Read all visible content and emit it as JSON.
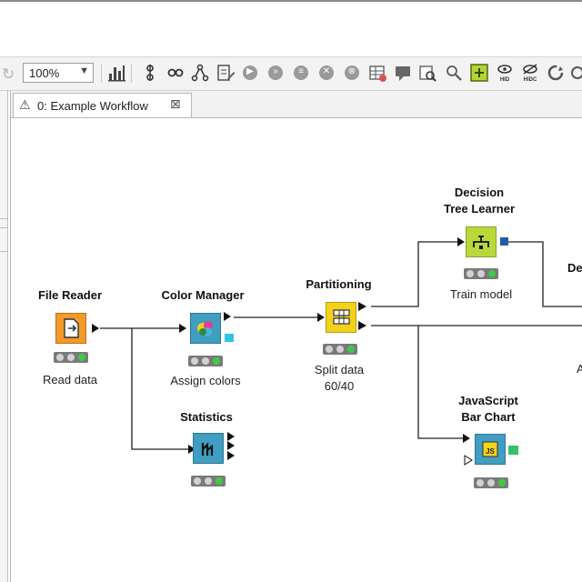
{
  "toolbar": {
    "zoom_value": "100%",
    "icons": [
      "redo-icon",
      "node-layout-icon",
      "align-icon",
      "link-icon",
      "tree-icon",
      "edit-icon",
      "execute-icon",
      "execute-all-icon",
      "step-icon",
      "cancel-icon",
      "cancel-all-icon",
      "reset-icon",
      "comment-icon",
      "find-icon",
      "zoom-icon",
      "grid-icon",
      "hide-icon",
      "hide-others-icon",
      "refresh-icon"
    ],
    "badge_hid": "HID",
    "badge_hidc": "HIDC"
  },
  "editor": {
    "tab": {
      "label": "0: Example Workflow",
      "icon": "warning-triangle-icon",
      "close": "close-icon"
    }
  },
  "workflow": {
    "nodes": {
      "file_reader": {
        "title": "File Reader",
        "description": "Read data",
        "color": "#f39a2b",
        "icon": "file-icon"
      },
      "color_manager": {
        "title": "Color Manager",
        "description": "Assign colors",
        "color": "#3f9ec1",
        "icon": "palette-icon"
      },
      "statistics": {
        "title": "Statistics",
        "description": "",
        "color": "#3f9ec1",
        "icon": "stats-icon"
      },
      "partitioning": {
        "title": "Partitioning",
        "description_line1": "Split data",
        "description_line2": "60/40",
        "color": "#f3d21b",
        "icon": "table-split-icon"
      },
      "dt_learner": {
        "title_line1": "Decision",
        "title_line2": "Tree Learner",
        "description": "Train model",
        "color": "#b9d93b",
        "icon": "tree-icon"
      },
      "js_bar_chart": {
        "title_line1": "JavaScript",
        "title_line2": "Bar Chart",
        "description": "",
        "color": "#3f9ec1",
        "icon": "js-icon",
        "js_label": "JS"
      },
      "cut_off_partial": {
        "title_fragment": "De",
        "description_fragment": "A"
      }
    },
    "colors": {
      "connection": "#202020",
      "status_bg": "#7a7a7a",
      "status_light": "#d2d2d2",
      "status_green": "#3fc94a",
      "model_port": "#1f5f9e",
      "data_port_cyan": "#31c3e0",
      "image_port_green": "#36c26b"
    }
  }
}
